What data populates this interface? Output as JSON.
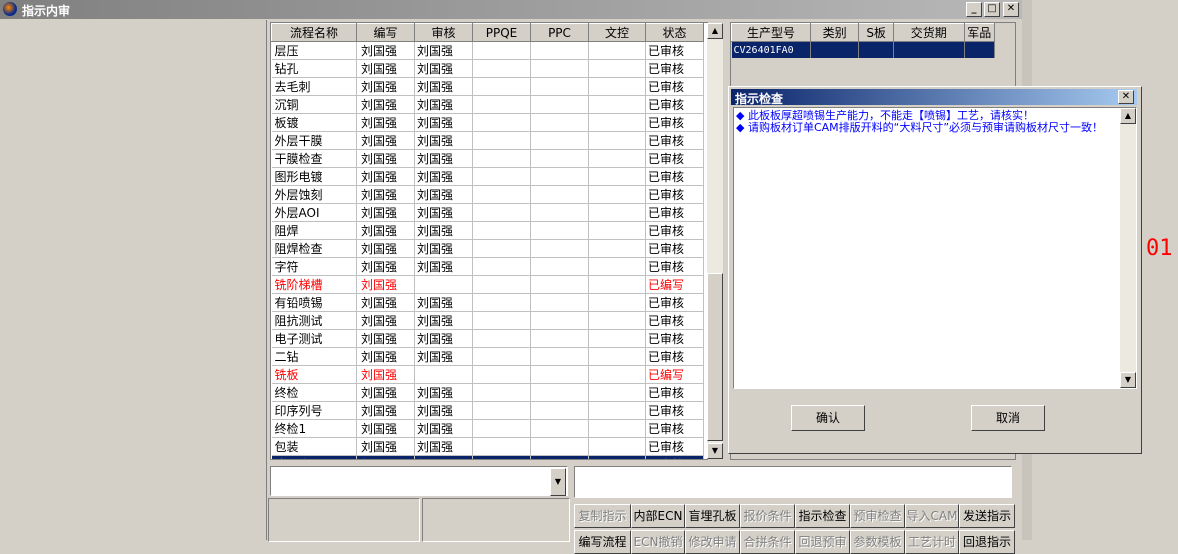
{
  "window": {
    "title": "指示内审"
  },
  "process_grid": {
    "columns": [
      "流程名称",
      "编写",
      "审核",
      "PPQE",
      "PPC",
      "文控",
      "状态"
    ],
    "rows": [
      {
        "name": "层压",
        "writer": "刘国强",
        "reviewer": "刘国强",
        "status": "已审核",
        "style": "normal"
      },
      {
        "name": "钻孔",
        "writer": "刘国强",
        "reviewer": "刘国强",
        "status": "已审核",
        "style": "normal"
      },
      {
        "name": "去毛刺",
        "writer": "刘国强",
        "reviewer": "刘国强",
        "status": "已审核",
        "style": "normal"
      },
      {
        "name": "沉铜",
        "writer": "刘国强",
        "reviewer": "刘国强",
        "status": "已审核",
        "style": "normal"
      },
      {
        "name": "板镀",
        "writer": "刘国强",
        "reviewer": "刘国强",
        "status": "已审核",
        "style": "normal"
      },
      {
        "name": "外层干膜",
        "writer": "刘国强",
        "reviewer": "刘国强",
        "status": "已审核",
        "style": "normal"
      },
      {
        "name": "干膜检查",
        "writer": "刘国强",
        "reviewer": "刘国强",
        "status": "已审核",
        "style": "normal"
      },
      {
        "name": "图形电镀",
        "writer": "刘国强",
        "reviewer": "刘国强",
        "status": "已审核",
        "style": "normal"
      },
      {
        "name": "外层蚀刻",
        "writer": "刘国强",
        "reviewer": "刘国强",
        "status": "已审核",
        "style": "normal"
      },
      {
        "name": "外层AOI",
        "writer": "刘国强",
        "reviewer": "刘国强",
        "status": "已审核",
        "style": "normal"
      },
      {
        "name": "阻焊",
        "writer": "刘国强",
        "reviewer": "刘国强",
        "status": "已审核",
        "style": "normal"
      },
      {
        "name": "阻焊检查",
        "writer": "刘国强",
        "reviewer": "刘国强",
        "status": "已审核",
        "style": "normal"
      },
      {
        "name": "字符",
        "writer": "刘国强",
        "reviewer": "刘国强",
        "status": "已审核",
        "style": "normal"
      },
      {
        "name": "铣阶梯槽",
        "writer": "刘国强",
        "reviewer": "",
        "status": "已编写",
        "style": "red"
      },
      {
        "name": "有铅喷锡",
        "writer": "刘国强",
        "reviewer": "刘国强",
        "status": "已审核",
        "style": "normal"
      },
      {
        "name": "阻抗测试",
        "writer": "刘国强",
        "reviewer": "刘国强",
        "status": "已审核",
        "style": "normal"
      },
      {
        "name": "电子测试",
        "writer": "刘国强",
        "reviewer": "刘国强",
        "status": "已审核",
        "style": "normal"
      },
      {
        "name": "二钻",
        "writer": "刘国强",
        "reviewer": "刘国强",
        "status": "已审核",
        "style": "normal"
      },
      {
        "name": "铣板",
        "writer": "刘国强",
        "reviewer": "",
        "status": "已编写",
        "style": "red"
      },
      {
        "name": "终检",
        "writer": "刘国强",
        "reviewer": "刘国强",
        "status": "已审核",
        "style": "normal"
      },
      {
        "name": "印序列号",
        "writer": "刘国强",
        "reviewer": "刘国强",
        "status": "已审核",
        "style": "normal"
      },
      {
        "name": "终检1",
        "writer": "刘国强",
        "reviewer": "刘国强",
        "status": "已审核",
        "style": "normal"
      },
      {
        "name": "包装",
        "writer": "刘国强",
        "reviewer": "刘国强",
        "status": "已审核",
        "style": "normal"
      },
      {
        "name": "成品仓",
        "writer": "刘国强",
        "reviewer": "刘国强",
        "status": "已审核",
        "style": "selected"
      }
    ]
  },
  "product_grid": {
    "columns": [
      "生产型号",
      "类别",
      "S板",
      "交货期",
      "军品"
    ],
    "rows": [
      {
        "model": "CV26401FA0",
        "category": "",
        "s_board": "",
        "delivery": "",
        "military": ""
      }
    ]
  },
  "dialog": {
    "title": "指示检查",
    "messages": [
      "◆ 此板板厚超喷锡生产能力，不能走【喷锡】工艺，请核实！",
      "◆ 请购板材订单CAM排版开料的“大料尺寸”必须与预审请购板材尺寸一致！"
    ],
    "ok_label": "确认",
    "cancel_label": "取消"
  },
  "toolbar": {
    "row1": [
      {
        "label": "复制指示",
        "enabled": false
      },
      {
        "label": "内部ECN",
        "enabled": true
      },
      {
        "label": "盲埋孔板",
        "enabled": true
      },
      {
        "label": "报价条件",
        "enabled": false
      },
      {
        "label": "指示检查",
        "enabled": true
      },
      {
        "label": "预审检查",
        "enabled": false
      },
      {
        "label": "导入CAM",
        "enabled": false
      },
      {
        "label": "发送指示",
        "enabled": true
      }
    ],
    "row2": [
      {
        "label": "编写流程",
        "enabled": true
      },
      {
        "label": "ECN撤销",
        "enabled": false
      },
      {
        "label": "修改申请",
        "enabled": false
      },
      {
        "label": "合拼条件",
        "enabled": false
      },
      {
        "label": "回退预审",
        "enabled": false
      },
      {
        "label": "参数模板",
        "enabled": false
      },
      {
        "label": "工艺计时",
        "enabled": false
      },
      {
        "label": "回退指示",
        "enabled": true
      }
    ]
  },
  "side_text": "01"
}
